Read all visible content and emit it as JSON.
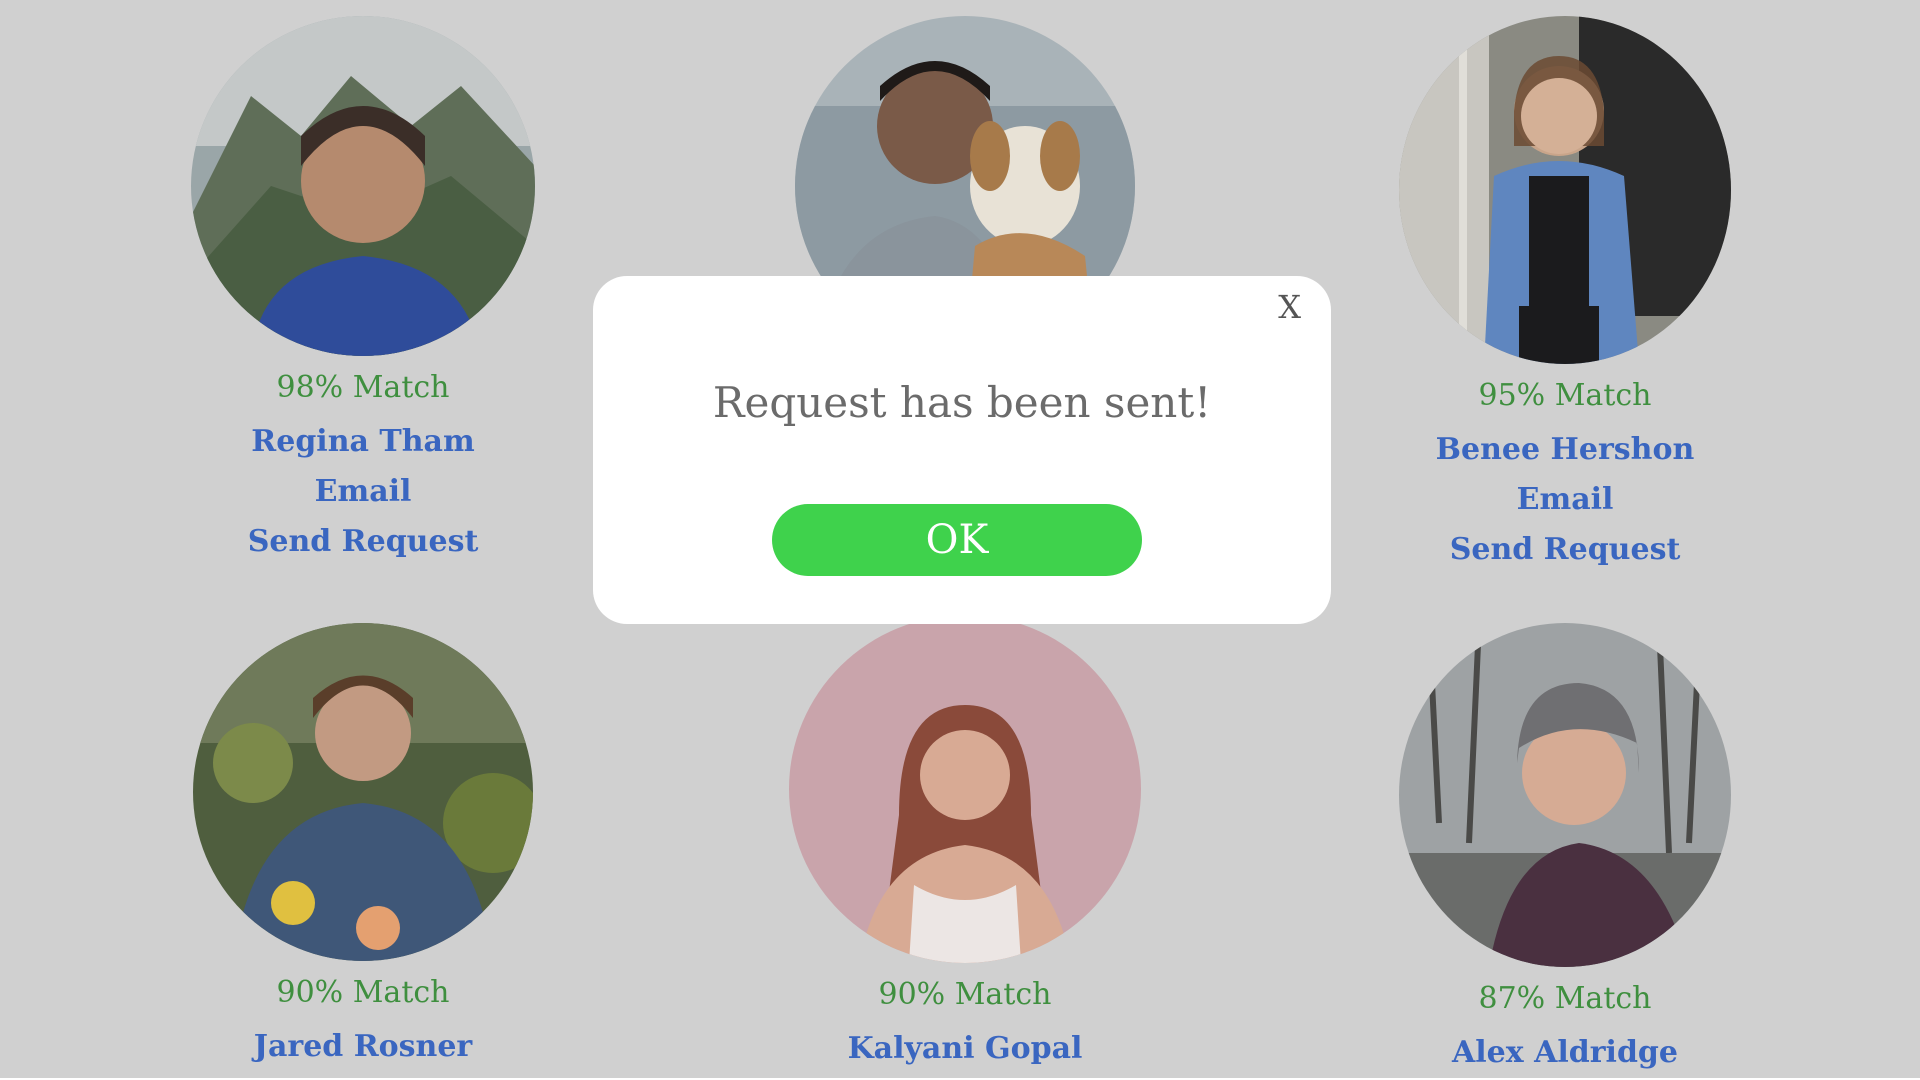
{
  "colors": {
    "background": "#d0d0d0",
    "match_text": "#3f8f3f",
    "link_text": "#3a66c0",
    "ok_button": "#3fd24c",
    "modal_background": "#ffffff"
  },
  "profiles": [
    {
      "match": "98% Match",
      "name": "Regina Tham",
      "email_label": "Email",
      "request_label": "Send Request",
      "photo_icon": "person-outdoors-mountains-photo"
    },
    {
      "match": "",
      "name": "",
      "email_label": "",
      "request_label": "",
      "photo_icon": "person-with-dog-beach-photo"
    },
    {
      "match": "95% Match",
      "name": "Benee Hershon",
      "email_label": "Email",
      "request_label": "Send Request",
      "photo_icon": "person-at-front-door-photo"
    },
    {
      "match": "90% Match",
      "name": "Jared Rosner",
      "email_label": "",
      "request_label": "",
      "photo_icon": "person-in-garden-photo"
    },
    {
      "match": "90% Match",
      "name": "Kalyani Gopal",
      "email_label": "",
      "request_label": "",
      "photo_icon": "person-pink-wall-photo"
    },
    {
      "match": "87% Match",
      "name": "Alex Aldridge",
      "email_label": "",
      "request_label": "",
      "photo_icon": "person-in-beanie-trees-photo"
    }
  ],
  "modal": {
    "close_label": "X",
    "message": "Request has been sent!",
    "ok_label": "OK"
  }
}
